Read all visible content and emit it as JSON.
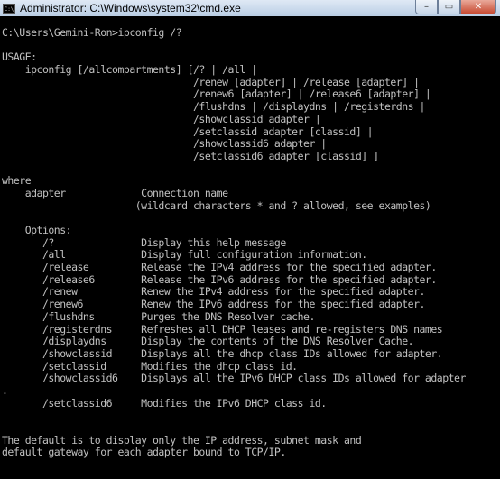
{
  "window": {
    "title": "Administrator: C:\\Windows\\system32\\cmd.exe",
    "icon_label": "C:\\",
    "controls": {
      "minimize": "–",
      "maximize": "▭",
      "close": "✕"
    }
  },
  "console": {
    "lines": [
      "C:\\Users\\Gemini-Ron>ipconfig /?",
      "",
      "USAGE:",
      "    ipconfig [/allcompartments] [/? | /all |",
      "                                 /renew [adapter] | /release [adapter] |",
      "                                 /renew6 [adapter] | /release6 [adapter] |",
      "                                 /flushdns | /displaydns | /registerdns |",
      "                                 /showclassid adapter |",
      "                                 /setclassid adapter [classid] |",
      "                                 /showclassid6 adapter |",
      "                                 /setclassid6 adapter [classid] ]",
      "",
      "where",
      "    adapter             Connection name",
      "                       (wildcard characters * and ? allowed, see examples)",
      "",
      "    Options:",
      "       /?               Display this help message",
      "       /all             Display full configuration information.",
      "       /release         Release the IPv4 address for the specified adapter.",
      "       /release6        Release the IPv6 address for the specified adapter.",
      "       /renew           Renew the IPv4 address for the specified adapter.",
      "       /renew6          Renew the IPv6 address for the specified adapter.",
      "       /flushdns        Purges the DNS Resolver cache.",
      "       /registerdns     Refreshes all DHCP leases and re-registers DNS names",
      "       /displaydns      Display the contents of the DNS Resolver Cache.",
      "       /showclassid     Displays all the dhcp class IDs allowed for adapter.",
      "       /setclassid      Modifies the dhcp class id.",
      "       /showclassid6    Displays all the IPv6 DHCP class IDs allowed for adapter",
      ".",
      "       /setclassid6     Modifies the IPv6 DHCP class id.",
      "",
      "",
      "The default is to display only the IP address, subnet mask and",
      "default gateway for each adapter bound to TCP/IP."
    ]
  }
}
